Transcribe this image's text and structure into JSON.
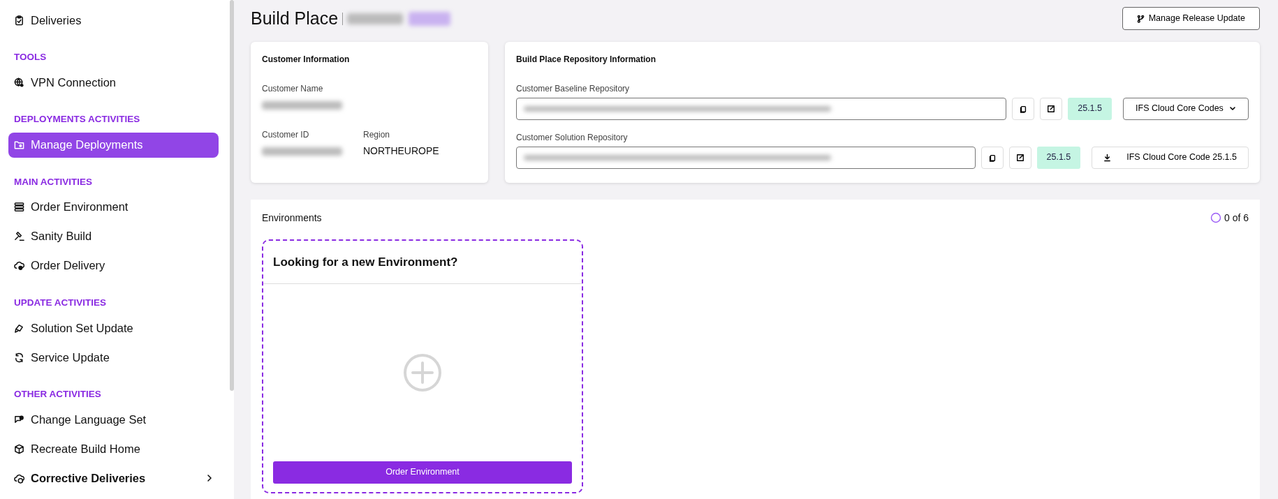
{
  "sidebar": {
    "items": [
      {
        "kind": "item",
        "label": "Deliveries",
        "selected": false,
        "bold": false,
        "has_submenu": false
      },
      {
        "kind": "section",
        "label": "TOOLS"
      },
      {
        "kind": "item",
        "label": "VPN Connection",
        "selected": false,
        "bold": false,
        "has_submenu": false
      },
      {
        "kind": "section",
        "label": "DEPLOYMENTS ACTIVITIES"
      },
      {
        "kind": "item",
        "label": "Manage Deployments",
        "selected": true,
        "bold": false,
        "has_submenu": false
      },
      {
        "kind": "section",
        "label": "MAIN ACTIVITIES"
      },
      {
        "kind": "item",
        "label": "Order Environment",
        "selected": false,
        "bold": false,
        "has_submenu": false
      },
      {
        "kind": "item",
        "label": "Sanity Build",
        "selected": false,
        "bold": false,
        "has_submenu": false
      },
      {
        "kind": "item",
        "label": "Order Delivery",
        "selected": false,
        "bold": false,
        "has_submenu": false
      },
      {
        "kind": "section",
        "label": "UPDATE ACTIVITIES"
      },
      {
        "kind": "item",
        "label": "Solution Set Update",
        "selected": false,
        "bold": false,
        "has_submenu": false
      },
      {
        "kind": "item",
        "label": "Service Update",
        "selected": false,
        "bold": false,
        "has_submenu": false
      },
      {
        "kind": "section",
        "label": "OTHER ACTIVITIES"
      },
      {
        "kind": "item",
        "label": "Change Language Set",
        "selected": false,
        "bold": false,
        "has_submenu": false
      },
      {
        "kind": "item",
        "label": "Recreate Build Home",
        "selected": false,
        "bold": false,
        "has_submenu": false
      },
      {
        "kind": "item",
        "label": "Corrective Deliveries",
        "selected": false,
        "bold": true,
        "has_submenu": true
      }
    ]
  },
  "header": {
    "title": "Build Place",
    "action_button": "Manage Release Update"
  },
  "customer_card": {
    "title": "Customer Information",
    "fields": [
      {
        "label": "Customer Name"
      },
      {
        "label": "Customer ID"
      },
      {
        "label": "Region",
        "value": "NORTHEUROPE"
      }
    ]
  },
  "repo_card": {
    "title": "Build Place Repository Information",
    "repos": [
      {
        "label": "Customer Baseline Repository",
        "version": "25.1.5",
        "action": {
          "kind": "dropdown",
          "label": "IFS Cloud Core Codes"
        }
      },
      {
        "label": "Customer Solution Repository",
        "version": "25.1.5",
        "action": {
          "kind": "download",
          "label": "IFS Cloud Core Code 25.1.5"
        }
      }
    ]
  },
  "environments": {
    "title": "Environments",
    "count": "0 of 6",
    "new_card": {
      "title": "Looking for a new Environment?",
      "button": "Order Environment"
    }
  }
}
